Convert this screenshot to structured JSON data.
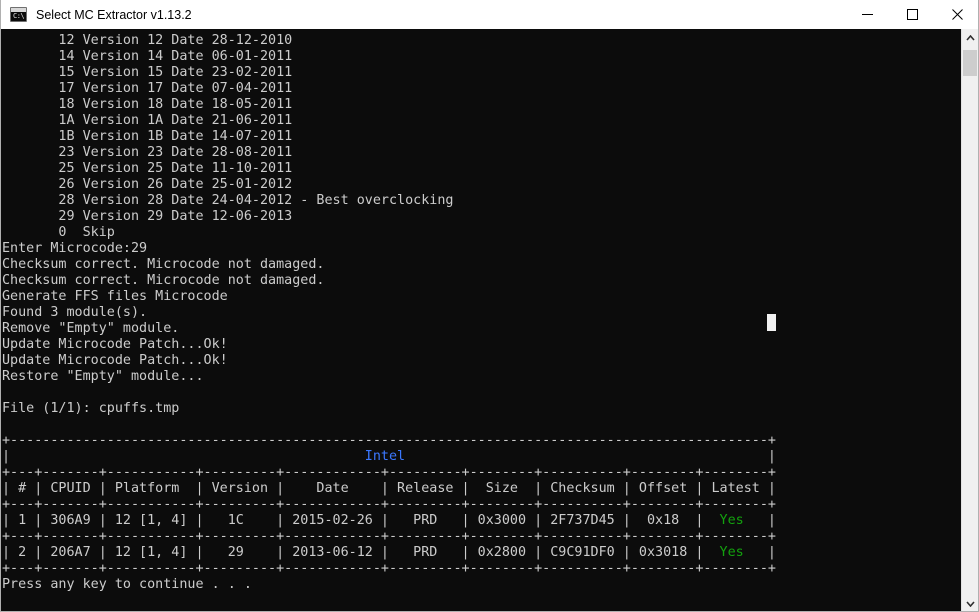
{
  "window": {
    "title": "Select MC Extractor v1.13.2",
    "icon": "console-icon",
    "icon_prompt": "C:\\",
    "controls": {
      "minimize": "minimize-icon",
      "maximize": "maximize-icon",
      "close": "close-icon"
    }
  },
  "colors": {
    "console_bg": "#0c0c0c",
    "console_fg": "#cccccc",
    "accent_blue": "#3b78ff",
    "accent_green": "#13a10e",
    "titlebar_bg": "#ffffff",
    "scrollbar_track": "#f0f0f0",
    "scrollbar_thumb": "#cdcdcd"
  },
  "console": {
    "microcode_menu": [
      "       12 Version 12 Date 28-12-2010",
      "       14 Version 14 Date 06-01-2011",
      "       15 Version 15 Date 23-02-2011",
      "       17 Version 17 Date 07-04-2011",
      "       18 Version 18 Date 18-05-2011",
      "       1A Version 1A Date 21-06-2011",
      "       1B Version 1B Date 14-07-2011",
      "       23 Version 23 Date 28-08-2011",
      "       25 Version 25 Date 11-10-2011",
      "       26 Version 26 Date 25-01-2012",
      "       28 Version 28 Date 24-04-2012 - Best overclocking",
      "       29 Version 29 Date 12-06-2013",
      "       0  Skip"
    ],
    "prompt_line": "Enter Microcode:29",
    "log_lines": [
      "Checksum correct. Microcode not damaged.",
      "Checksum correct. Microcode not damaged.",
      "Generate FFS files Microcode",
      "Found 3 module(s).",
      "Remove \"Empty\" module.",
      "Update Microcode Patch...Ok!",
      "Update Microcode Patch...Ok!",
      "Restore \"Empty\" module..."
    ],
    "file_line": "File (1/1): cpuffs.tmp",
    "footer": "Press any key to continue . . ."
  },
  "table": {
    "vendor_title": "Intel",
    "columns": [
      "#",
      "CPUID",
      "Platform",
      "Version",
      "Date",
      "Release",
      "Size",
      "Checksum",
      "Offset",
      "Latest"
    ],
    "rows": [
      {
        "num": "1",
        "cpuid": "306A9",
        "platform": "12 [1, 4]",
        "version": "1C",
        "date": "2015-02-26",
        "release": "PRD",
        "size": "0x3000",
        "checksum": "2F737D45",
        "offset": "0x18",
        "latest": "Yes"
      },
      {
        "num": "2",
        "cpuid": "206A7",
        "platform": "12 [1, 4]",
        "version": "29",
        "date": "2013-06-12",
        "release": "PRD",
        "size": "0x2800",
        "checksum": "C9C91DF0",
        "offset": "0x3018",
        "latest": "Yes"
      }
    ]
  },
  "scrollbar": {
    "up_arrow": "chevron-up-icon",
    "down_arrow": "chevron-down-icon"
  }
}
